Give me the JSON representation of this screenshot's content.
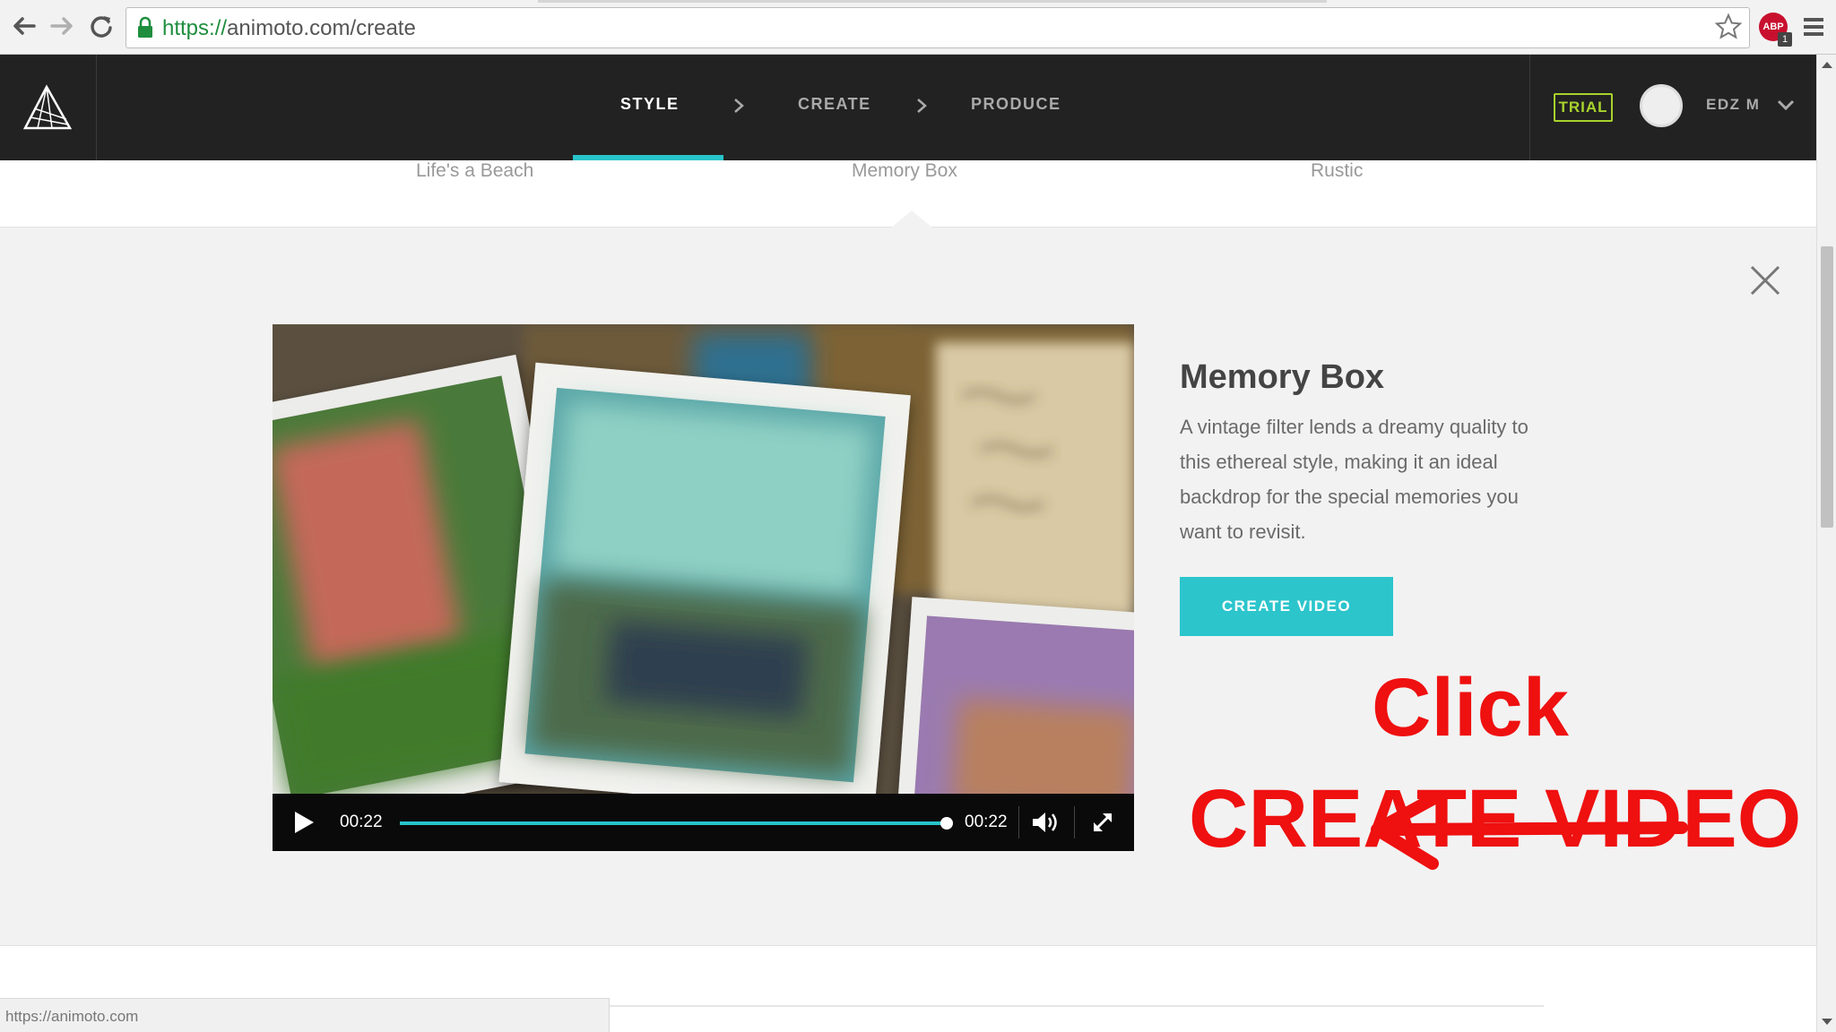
{
  "browser": {
    "url_scheme": "https://",
    "url_rest": "animoto.com/create",
    "status_url": "https://animoto.com",
    "adblock_label": "ABP",
    "adblock_count": "1"
  },
  "header": {
    "steps": [
      "STYLE",
      "CREATE",
      "PRODUCE"
    ],
    "active_step": "STYLE",
    "trial_badge": "TRIAL",
    "user_name": "EDZ M"
  },
  "styles_strip": {
    "items": [
      "Life's a Beach",
      "Memory Box",
      "Rustic"
    ],
    "selected": "Memory Box"
  },
  "detail": {
    "title": "Memory Box",
    "description": "A vintage filter lends a dreamy quality to this ethereal style, making it an ideal backdrop for the special memories you want to revisit.",
    "cta_label": "CREATE VIDEO"
  },
  "player": {
    "elapsed": "00:22",
    "duration": "00:22",
    "progress": 1.0
  },
  "annotation": {
    "line1": "Click",
    "line2": "CREATE VIDEO",
    "color": "#ef1010"
  },
  "colors": {
    "accent": "#28c4c9",
    "trial": "#a8d32c",
    "header_bg": "#222222",
    "panel_bg": "#f2f2f2"
  },
  "icons": [
    "back-arrow-icon",
    "forward-arrow-icon",
    "reload-icon",
    "lock-icon",
    "star-icon",
    "adblock-icon",
    "chrome-menu-icon",
    "animoto-logo-icon",
    "chevron-right-icon",
    "chevron-down-icon",
    "close-icon",
    "play-icon",
    "volume-icon",
    "fullscreen-icon"
  ]
}
